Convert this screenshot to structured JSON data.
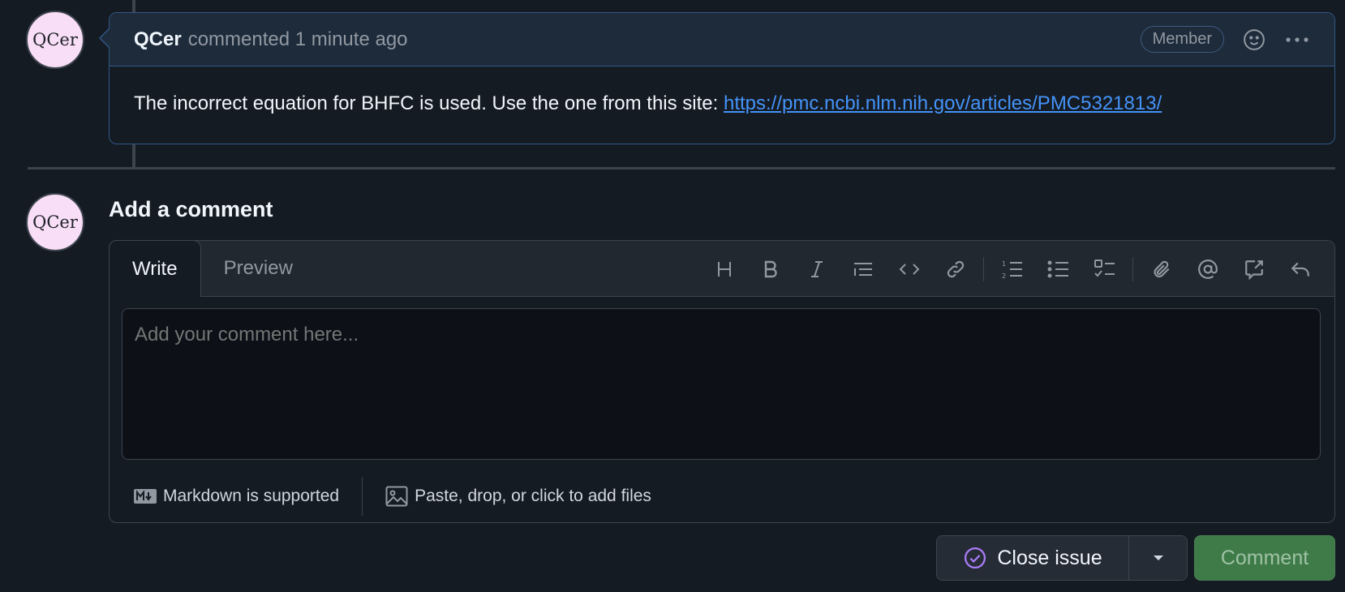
{
  "comment": {
    "avatar_text": "QCer",
    "author": "QCer",
    "meta": "commented 1 minute ago",
    "badge": "Member",
    "body_text": "The incorrect equation for BHFC is used. Use the one from this site: ",
    "link": "https://pmc.ncbi.nlm.nih.gov/articles/PMC5321813/"
  },
  "composer": {
    "avatar_text": "QCer",
    "title": "Add a comment",
    "tabs": [
      "Write",
      "Preview"
    ],
    "placeholder": "Add your comment here...",
    "markdown_note": "Markdown is supported",
    "files_note": "Paste, drop, or click to add files",
    "toolbar_icons": [
      "heading-icon",
      "bold-icon",
      "italic-icon",
      "quote-icon",
      "code-icon",
      "link-icon",
      "numbered-list-icon",
      "bulleted-list-icon",
      "task-list-icon",
      "attach-icon",
      "mention-icon",
      "reference-icon",
      "undo-icon"
    ]
  },
  "actions": {
    "close_label": "Close issue",
    "comment_label": "Comment"
  },
  "colors": {
    "background": "#151b23",
    "link": "#4493f8",
    "accent_purple": "#ab7df8",
    "comment_button": "#3f7a49"
  }
}
